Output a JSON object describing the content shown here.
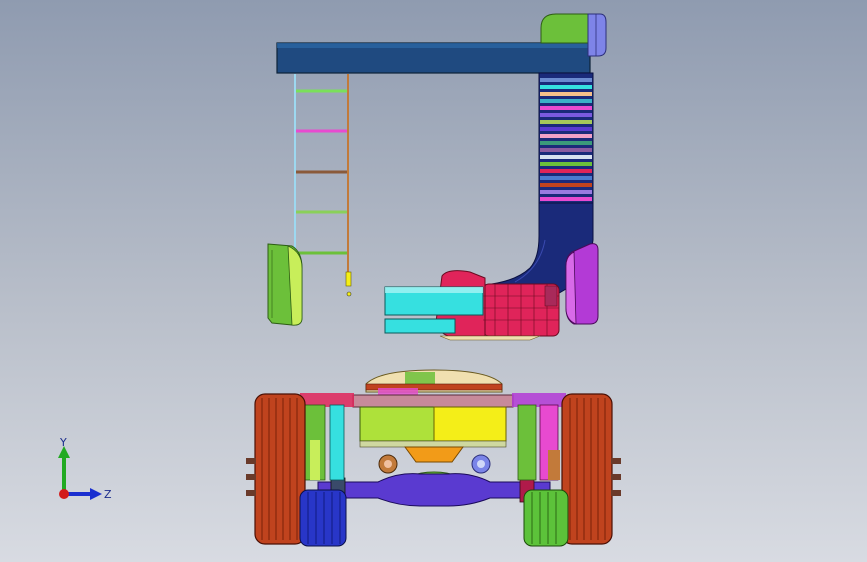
{
  "window": {
    "background_top": "#8f9bb0",
    "background_bottom": "#d8dbe2"
  },
  "triad": {
    "y_label": "Y",
    "z_label": "Z",
    "y_color": "#22aa22",
    "z_color": "#1a2fd0",
    "x_origin_color": "#d21a1a"
  },
  "model": {
    "colors": {
      "deck": "#1f4a80",
      "duct": "#1a2a7a",
      "intake": "#e0245a",
      "pipe": "#36e0e0",
      "fender_left": "#6cc03a",
      "fender_right": "#b33ad6",
      "tire": "#c0431e",
      "tire_blue": "#2836c8",
      "tire_green": "#5cc23a",
      "axle": "#5a3ad0",
      "gearbox_left": "#aee13a",
      "gearbox_right": "#f4ee18",
      "diff": "#f29b18"
    }
  }
}
